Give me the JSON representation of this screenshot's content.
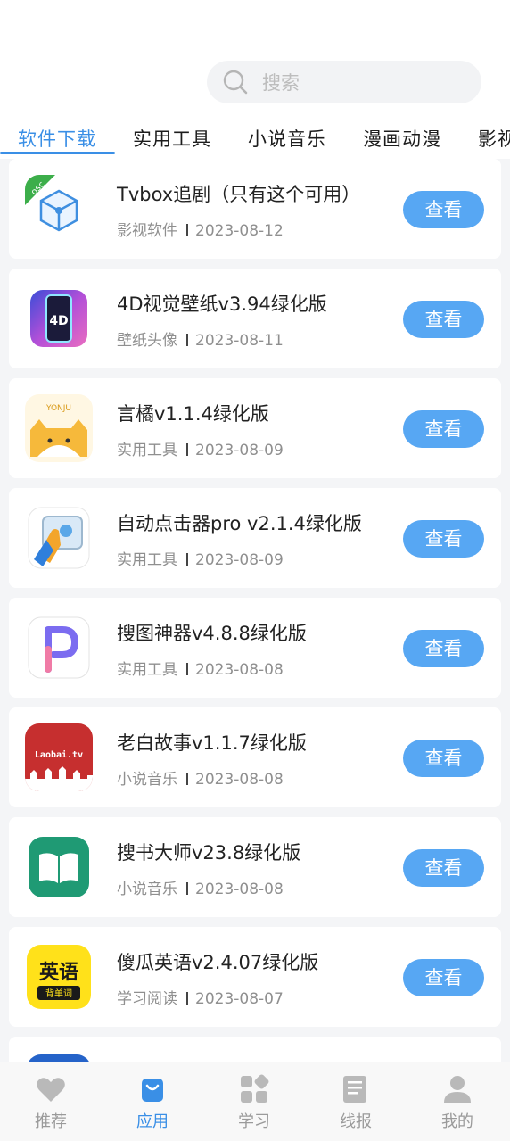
{
  "search": {
    "placeholder": "搜索"
  },
  "tabs": [
    {
      "label": "软件下载",
      "active": true
    },
    {
      "label": "实用工具",
      "active": false
    },
    {
      "label": "小说音乐",
      "active": false
    },
    {
      "label": "漫画动漫",
      "active": false
    },
    {
      "label": "影视",
      "active": false
    }
  ],
  "apps": [
    {
      "title": "Tvbox追剧（只有这个可用）",
      "category": "影视软件",
      "date": "2023-08-12",
      "button": "查看",
      "badge": "osc"
    },
    {
      "title": "4D视觉壁纸v3.94绿化版",
      "category": "壁纸头像",
      "date": "2023-08-11",
      "button": "查看",
      "icon_text": "4D"
    },
    {
      "title": "言橘v1.1.4绿化版",
      "category": "实用工具",
      "date": "2023-08-09",
      "button": "查看",
      "icon_text": "YONJU"
    },
    {
      "title": "自动点击器pro  v2.1.4绿化版",
      "category": "实用工具",
      "date": "2023-08-09",
      "button": "查看"
    },
    {
      "title": "搜图神器v4.8.8绿化版",
      "category": "实用工具",
      "date": "2023-08-08",
      "button": "查看"
    },
    {
      "title": "老白故事v1.1.7绿化版",
      "category": "小说音乐",
      "date": "2023-08-08",
      "button": "查看",
      "icon_text": "Laobai.tv"
    },
    {
      "title": "搜书大师v23.8绿化版",
      "category": "小说音乐",
      "date": "2023-08-08",
      "button": "查看"
    },
    {
      "title": "傻瓜英语v2.4.07绿化版",
      "category": "学习阅读",
      "date": "2023-08-07",
      "button": "查看",
      "icon_text": "英语",
      "icon_subtext": "背单词"
    }
  ],
  "nav": [
    {
      "label": "推荐",
      "icon": "heart-icon",
      "active": false
    },
    {
      "label": "应用",
      "icon": "bag-icon",
      "active": true
    },
    {
      "label": "学习",
      "icon": "grid-icon",
      "active": false
    },
    {
      "label": "线报",
      "icon": "news-icon",
      "active": false
    },
    {
      "label": "我的",
      "icon": "user-icon",
      "active": false
    }
  ],
  "colors": {
    "accent": "#3a8fe6",
    "button": "#57a7f3"
  }
}
